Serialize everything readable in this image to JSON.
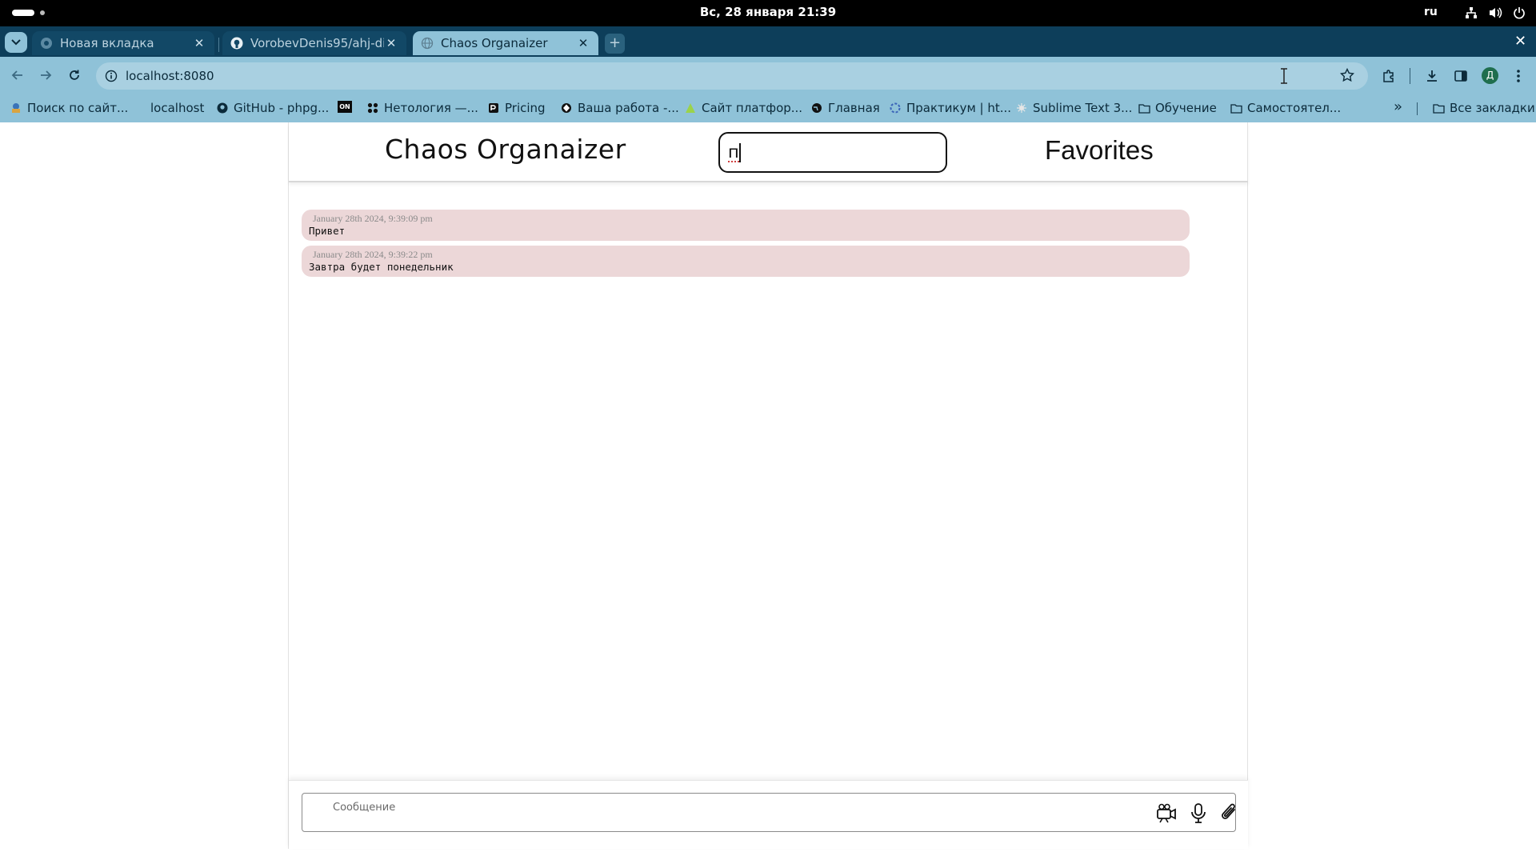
{
  "system": {
    "clock": "Вс, 28 января  21:39",
    "language": "ru"
  },
  "browser": {
    "tabs": [
      {
        "title": "Новая вкладка",
        "favicon": "chrome-icon",
        "active": false
      },
      {
        "title": "VorobevDenis95/ahj-diploma",
        "favicon": "github-icon",
        "active": false
      },
      {
        "title": "Chaos Organaizer",
        "favicon": "globe-icon",
        "active": true
      }
    ],
    "new_tab": "+",
    "url": "localhost:8080",
    "profile_initial": "Д",
    "bookmarks": [
      {
        "label": "Поиск по сайт...",
        "icon": "search-site-icon"
      },
      {
        "label": "localhost",
        "icon": "none"
      },
      {
        "label": "GitHub - phpg...",
        "icon": "github-icon"
      },
      {
        "label": "ON",
        "icon": "on-badge-icon"
      },
      {
        "label": "Нетология —...",
        "icon": "netology-icon"
      },
      {
        "label": "Pricing",
        "icon": "pricing-icon"
      },
      {
        "label": "Ваша работа -...",
        "icon": "work-icon"
      },
      {
        "label": "Сайт платфор...",
        "icon": "platform-icon"
      },
      {
        "label": "Главная",
        "icon": "globe-icon"
      },
      {
        "label": "Практикум | ht...",
        "icon": "practicum-icon"
      },
      {
        "label": "Sublime Text 3...",
        "icon": "sublime-icon"
      },
      {
        "label": "Обучение",
        "icon": "folder-icon"
      },
      {
        "label": "Самостоятел...",
        "icon": "folder-icon"
      }
    ],
    "more_bookmarks": "»",
    "all_bookmarks": "Все закладки"
  },
  "app": {
    "title": "Chaos Organaizer",
    "search_value": "п",
    "favorites_label": "Favorites",
    "messages": [
      {
        "time": "January 28th 2024, 9:39:09 pm",
        "text": "Привет"
      },
      {
        "time": "January 28th 2024, 9:39:22 pm",
        "text": "Завтра будет понедельник"
      }
    ],
    "composer": {
      "placeholder": "Сообщение",
      "icons": [
        "video-camera-icon",
        "microphone-icon",
        "paperclip-icon"
      ]
    }
  },
  "colors": {
    "tab_strip": "#0d3e5a",
    "toolbar": "#8fc2d8",
    "message_bubble": "#ecd7d8"
  }
}
